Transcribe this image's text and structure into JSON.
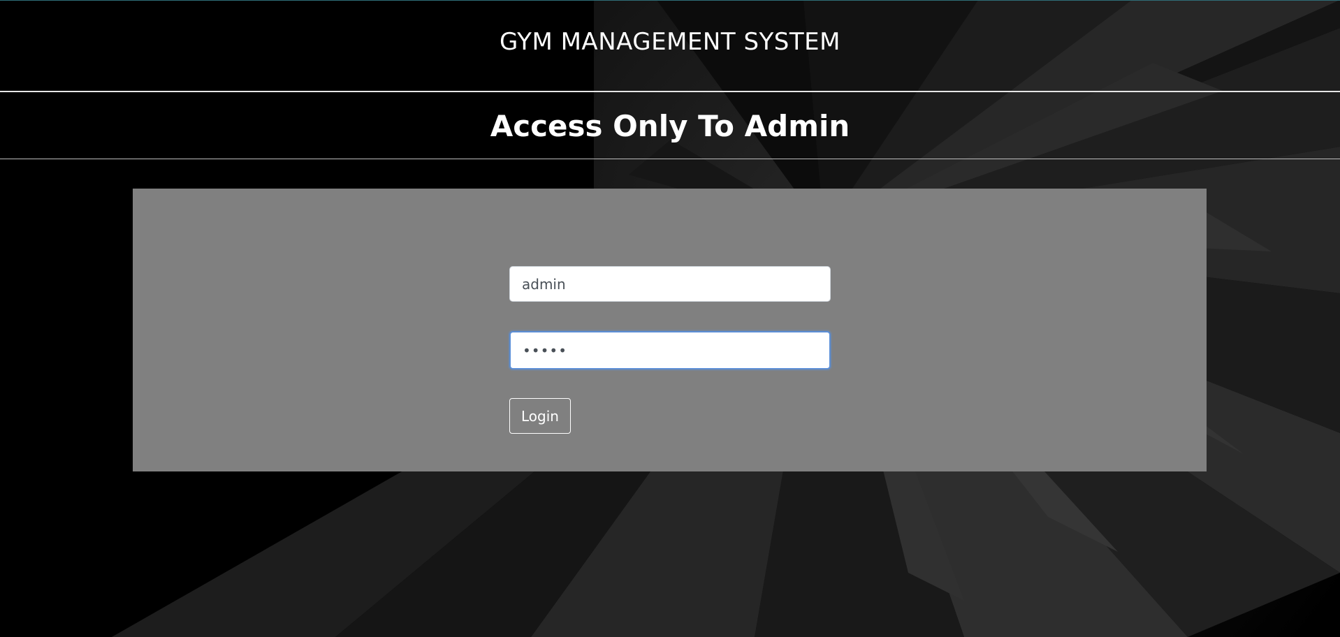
{
  "header": {
    "site_title": "GYM MANAGEMENT SYSTEM",
    "page_heading": "Access Only To Admin"
  },
  "login_form": {
    "username_value": "admin",
    "password_value": "•••••",
    "login_label": "Login"
  },
  "colors": {
    "background": "#000000",
    "panel": "#808080",
    "focus_border": "#5b8ed6"
  }
}
